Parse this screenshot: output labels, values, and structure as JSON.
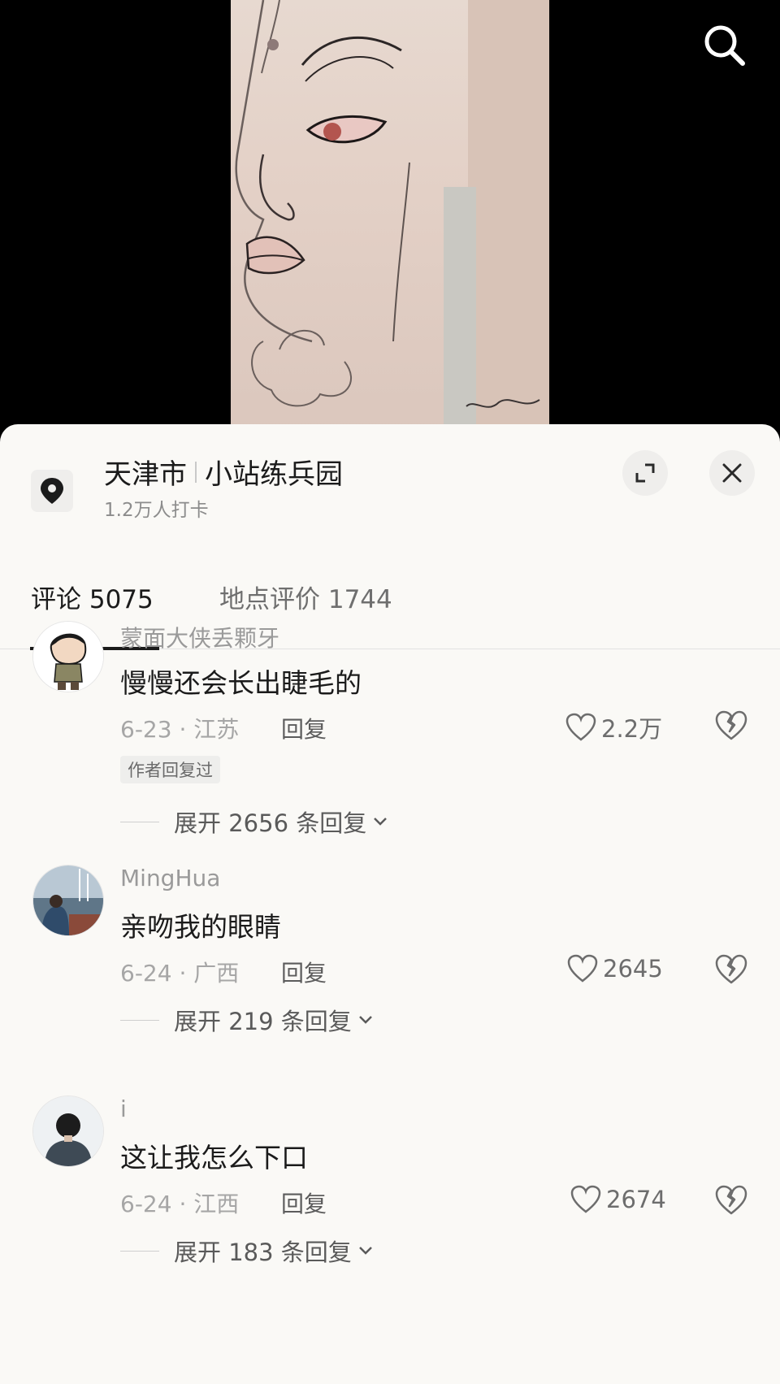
{
  "location": {
    "city": "天津市",
    "place": "小站练兵园",
    "checkins": "1.2万人打卡"
  },
  "tabs": [
    {
      "label": "评论 5075",
      "active": true
    },
    {
      "label": "地点评价 1744",
      "active": false
    }
  ],
  "comments": [
    {
      "username": "蒙面大侠丢颗牙",
      "text": "慢慢还会长出睫毛的",
      "meta": "6-23 · 江苏",
      "reply": "回复",
      "likes": "2.2万",
      "badge": "作者回复过",
      "expand": "展开 2656 条回复"
    },
    {
      "username": "MingHua",
      "text": "亲吻我的眼睛",
      "meta": "6-24 · 广西",
      "reply": "回复",
      "likes": "2645",
      "expand": "展开 219 条回复"
    },
    {
      "username": "i",
      "text": "这让我怎么下口",
      "meta": "6-24 · 江西",
      "reply": "回复",
      "likes": "2674",
      "expand": "展开 183 条回复"
    }
  ],
  "icons": {
    "search": "search-icon",
    "location": "location-pin-icon",
    "expand": "expand-icon",
    "close": "close-icon",
    "like": "heart-icon",
    "dislike": "broken-heart-icon",
    "chevron": "chevron-down-icon"
  },
  "colors": {
    "sheet_bg": "#faf9f6",
    "text_primary": "#1b1b1b",
    "text_secondary": "#9a9a9a"
  }
}
